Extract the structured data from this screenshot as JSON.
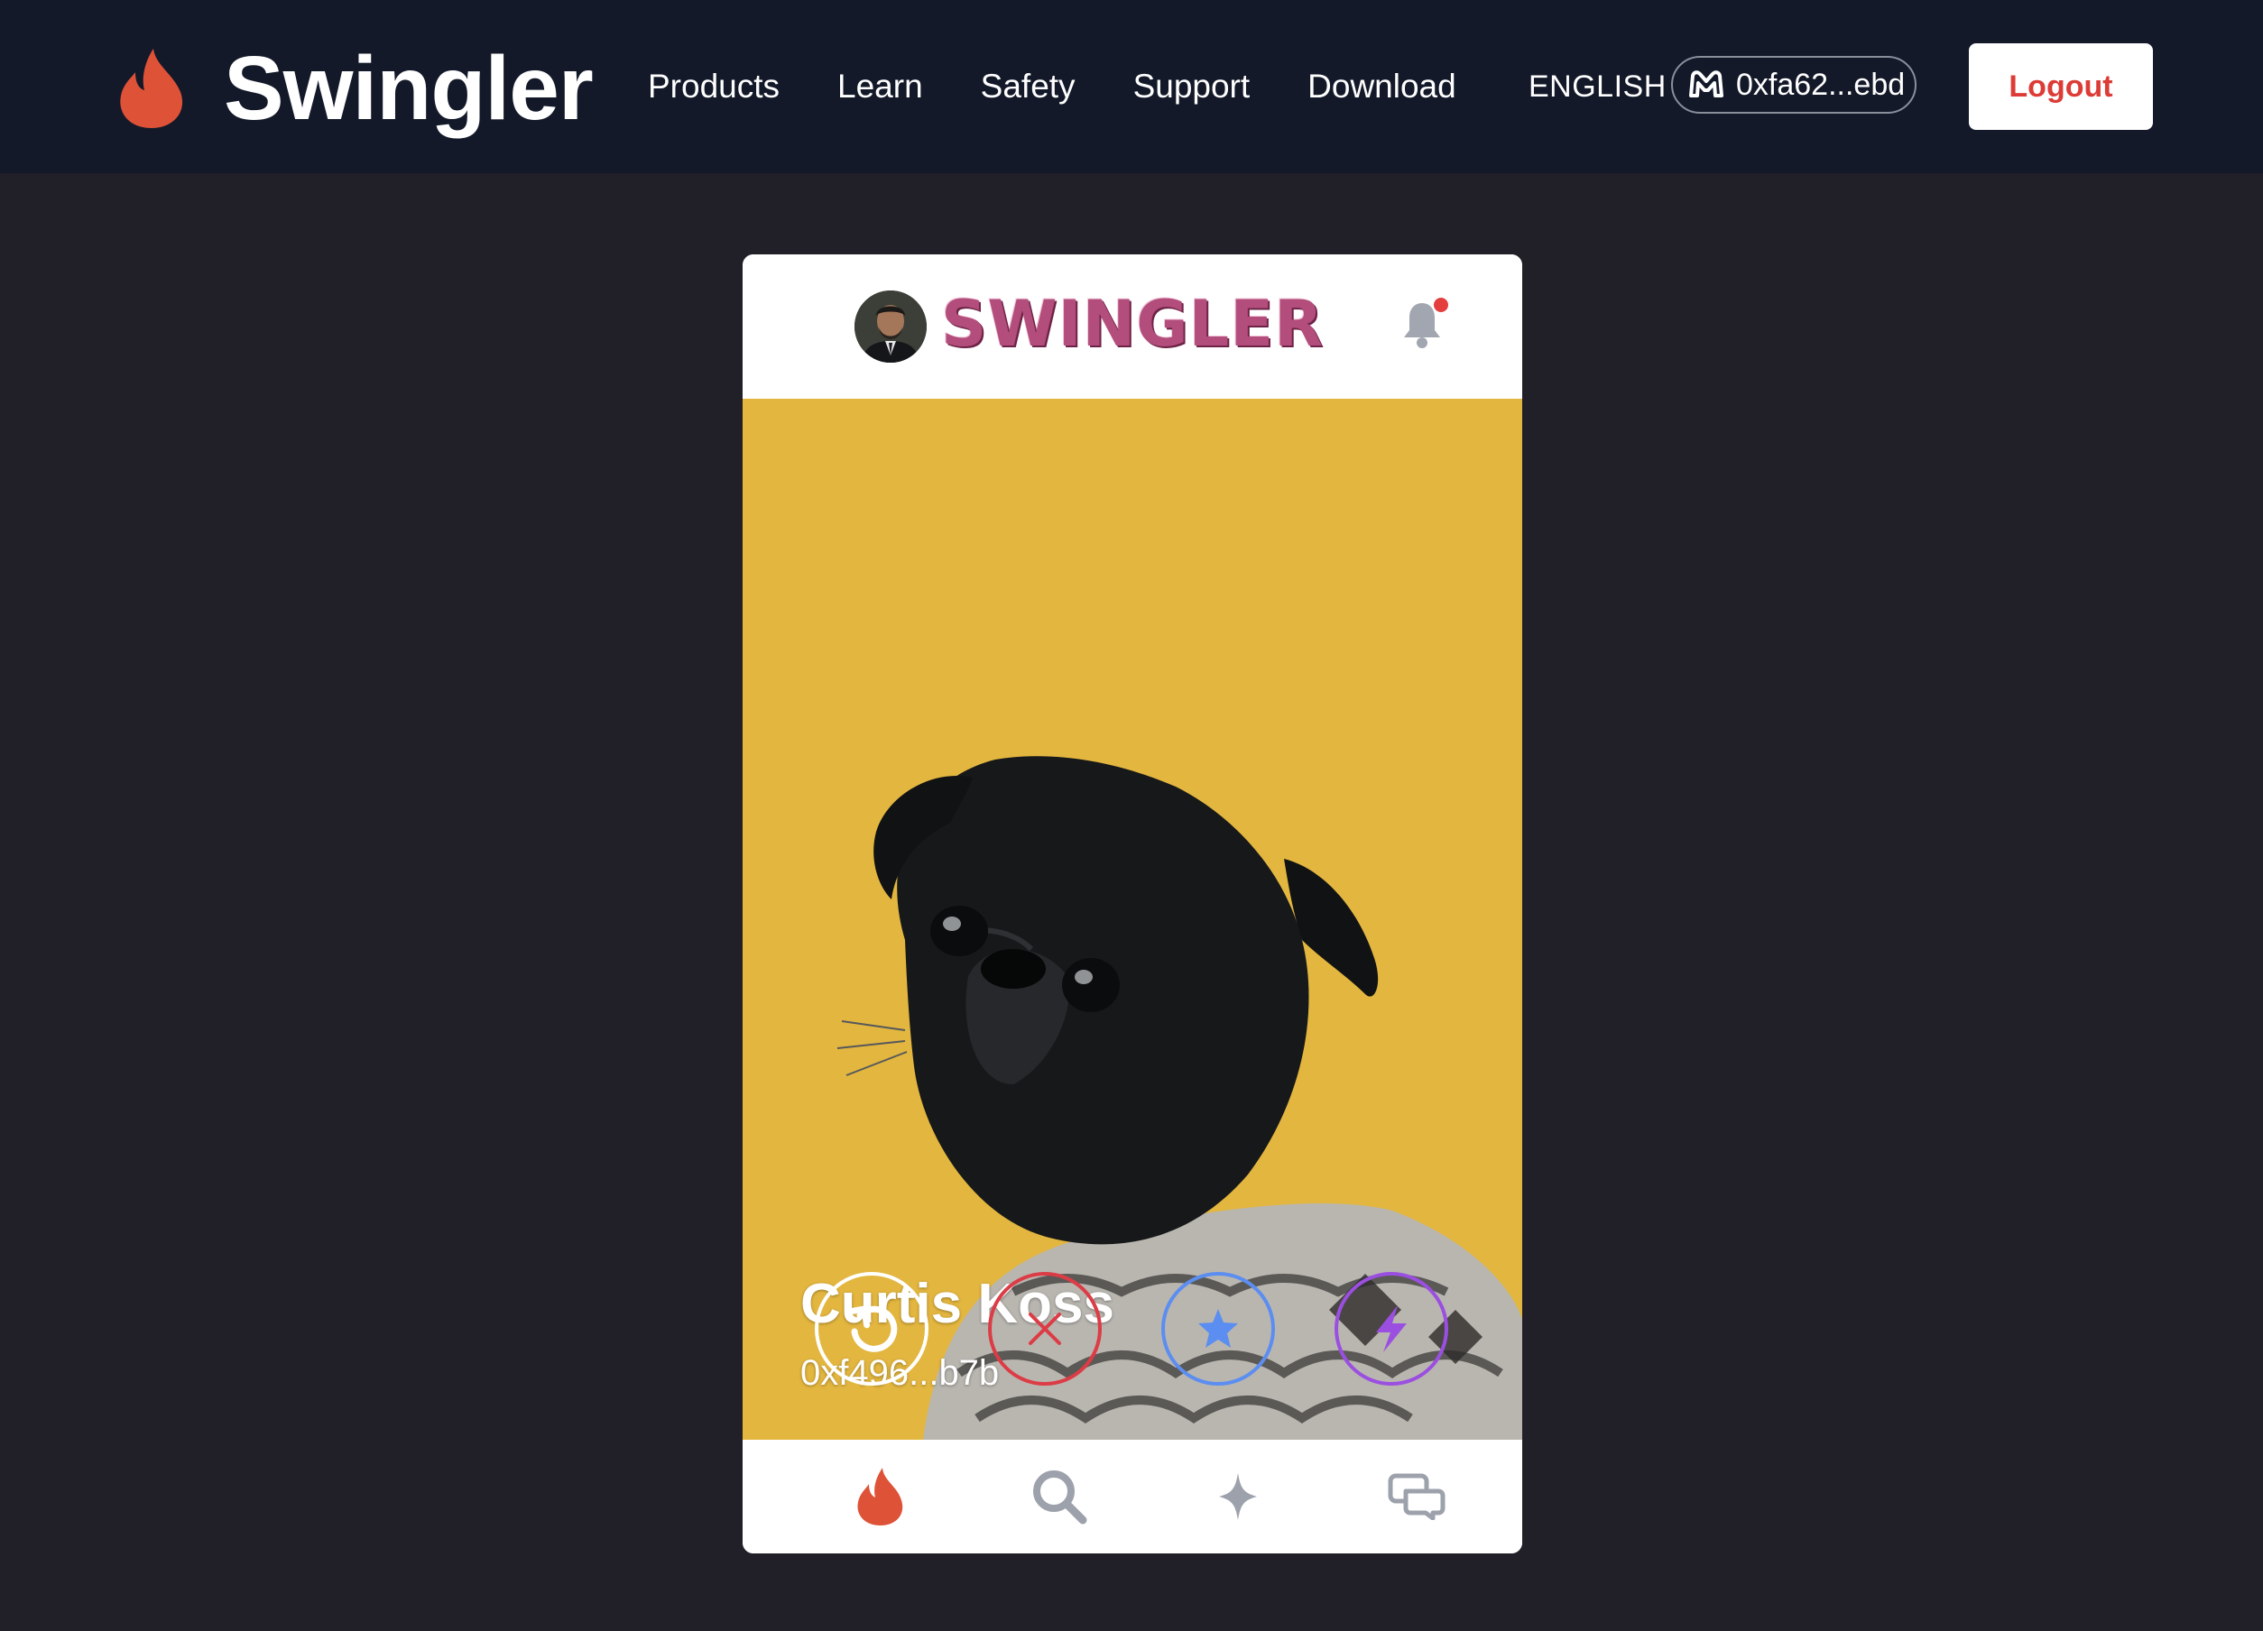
{
  "navbar": {
    "brand": "Swingler",
    "links": [
      "Products",
      "Learn",
      "Safety",
      "Support",
      "Download"
    ],
    "language": "ENGLISH",
    "wallet_address": "0xfa62...ebd",
    "logout_label": "Logout"
  },
  "app": {
    "logo_text": "SWINGLER",
    "has_notification": true
  },
  "profile": {
    "name": "Curtis Koss",
    "address": "0xf496...b7b"
  },
  "actions": [
    {
      "icon": "rewind-icon",
      "color": "#ffffff"
    },
    {
      "icon": "close-icon",
      "color": "#dc3c45"
    },
    {
      "icon": "star-icon",
      "color": "#5b8ef0"
    },
    {
      "icon": "lightning-icon",
      "color": "#9b4fe0"
    }
  ],
  "bottom_tabs": [
    {
      "icon": "flame-icon",
      "active": true
    },
    {
      "icon": "search-icon",
      "active": false
    },
    {
      "icon": "sparkle-icon",
      "active": false
    },
    {
      "icon": "chat-icon",
      "active": false
    }
  ],
  "colors": {
    "navbar_bg": "#131929",
    "page_bg": "#212028",
    "brand_flame": "#de5238",
    "logout_text": "#dd3b36",
    "photo_bg": "#e3b63f",
    "logo_pink": "#b24d7c"
  }
}
